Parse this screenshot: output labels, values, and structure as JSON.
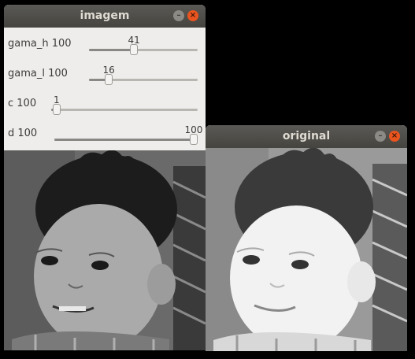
{
  "windows": {
    "imagem": {
      "title": "imagem",
      "trackbars": [
        {
          "label": "gama_h 100",
          "value": "41",
          "fraction": 0.41
        },
        {
          "label": "gama_l 100",
          "value": "16",
          "fraction": 0.16
        },
        {
          "label": "c 100",
          "value": "1",
          "fraction": 0.01
        },
        {
          "label": "d 100",
          "value": "100",
          "fraction": 1.0
        }
      ]
    },
    "original": {
      "title": "original"
    }
  },
  "icons": {
    "minimize": "minimize-icon",
    "close": "close-icon"
  },
  "colors": {
    "titlebar": "#45443f",
    "close_button": "#e9541f",
    "panel": "#efedeb"
  }
}
